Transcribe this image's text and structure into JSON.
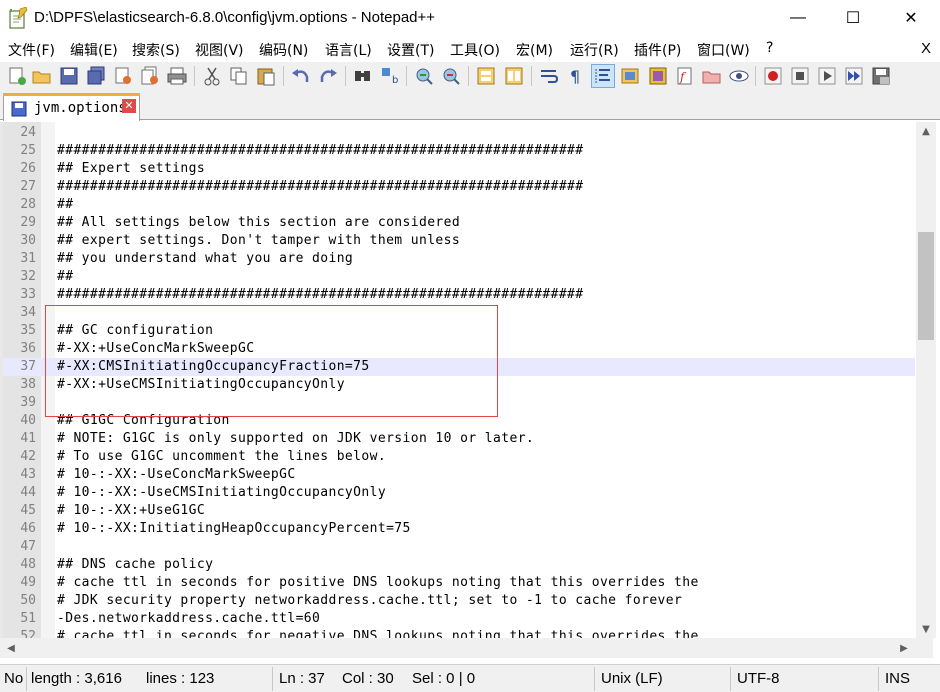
{
  "window": {
    "title": "D:\\DPFS\\elasticsearch-6.8.0\\config\\jvm.options - Notepad++",
    "minimize": "—",
    "maximize": "☐",
    "close": "✕"
  },
  "menu": {
    "items": [
      "文件(F)",
      "编辑(E)",
      "搜索(S)",
      "视图(V)",
      "编码(N)",
      "语言(L)",
      "设置(T)",
      "工具(O)",
      "宏(M)",
      "运行(R)",
      "插件(P)",
      "窗口(W)",
      "?"
    ],
    "close_doc": "X"
  },
  "toolbar": {
    "icons": [
      "new-file-icon",
      "open-file-icon",
      "save-icon",
      "save-all-icon",
      "close-icon",
      "close-all-icon",
      "print-icon",
      "cut-icon",
      "copy-icon",
      "paste-icon",
      "undo-icon",
      "redo-icon",
      "find-icon",
      "replace-icon",
      "zoom-in-icon",
      "zoom-out-icon",
      "sync-vertical-icon",
      "sync-horizontal-icon",
      "word-wrap-icon",
      "show-all-chars-icon",
      "indent-guide-icon",
      "user-lang-icon",
      "doc-map-icon",
      "function-list-icon",
      "folder-workspace-icon",
      "monitoring-icon",
      "record-macro-icon",
      "stop-macro-icon",
      "play-macro-icon",
      "run-macro-multiple-icon",
      "save-macro-icon"
    ]
  },
  "tab": {
    "label": "jvm.options",
    "close": "✕"
  },
  "editor": {
    "current_line": 37,
    "lines": [
      {
        "num": "24",
        "text": ""
      },
      {
        "num": "25",
        "text": "################################################################"
      },
      {
        "num": "26",
        "text": "## Expert settings"
      },
      {
        "num": "27",
        "text": "################################################################"
      },
      {
        "num": "28",
        "text": "##"
      },
      {
        "num": "29",
        "text": "## All settings below this section are considered"
      },
      {
        "num": "30",
        "text": "## expert settings. Don't tamper with them unless"
      },
      {
        "num": "31",
        "text": "## you understand what you are doing"
      },
      {
        "num": "32",
        "text": "##"
      },
      {
        "num": "33",
        "text": "################################################################"
      },
      {
        "num": "34",
        "text": ""
      },
      {
        "num": "35",
        "text": "## GC configuration"
      },
      {
        "num": "36",
        "text": "#-XX:+UseConcMarkSweepGC"
      },
      {
        "num": "37",
        "text": "#-XX:CMSInitiatingOccupancyFraction=75"
      },
      {
        "num": "38",
        "text": "#-XX:+UseCMSInitiatingOccupancyOnly"
      },
      {
        "num": "39",
        "text": ""
      },
      {
        "num": "40",
        "text": "## G1GC Configuration"
      },
      {
        "num": "41",
        "text": "# NOTE: G1GC is only supported on JDK version 10 or later."
      },
      {
        "num": "42",
        "text": "# To use G1GC uncomment the lines below."
      },
      {
        "num": "43",
        "text": "# 10-:-XX:-UseConcMarkSweepGC"
      },
      {
        "num": "44",
        "text": "# 10-:-XX:-UseCMSInitiatingOccupancyOnly"
      },
      {
        "num": "45",
        "text": "# 10-:-XX:+UseG1GC"
      },
      {
        "num": "46",
        "text": "# 10-:-XX:InitiatingHeapOccupancyPercent=75"
      },
      {
        "num": "47",
        "text": ""
      },
      {
        "num": "48",
        "text": "## DNS cache policy"
      },
      {
        "num": "49",
        "text": "# cache ttl in seconds for positive DNS lookups noting that this overrides the"
      },
      {
        "num": "50",
        "text": "# JDK security property networkaddress.cache.ttl; set to -1 to cache forever"
      },
      {
        "num": "51",
        "text": "-Des.networkaddress.cache.ttl=60"
      },
      {
        "num": "52",
        "text": "# cache ttl in seconds for negative DNS lookups noting that this overrides the"
      }
    ]
  },
  "scrollbars": {
    "up": "▲",
    "down": "▼",
    "left": "◀",
    "right": "▶"
  },
  "status": {
    "doc_type": "No",
    "length": "length : 3,616",
    "lines": "lines : 123",
    "ln": "Ln : 37",
    "col": "Col : 30",
    "sel": "Sel : 0 | 0",
    "eol": "Unix (LF)",
    "encoding": "UTF-8",
    "mode": "INS"
  }
}
